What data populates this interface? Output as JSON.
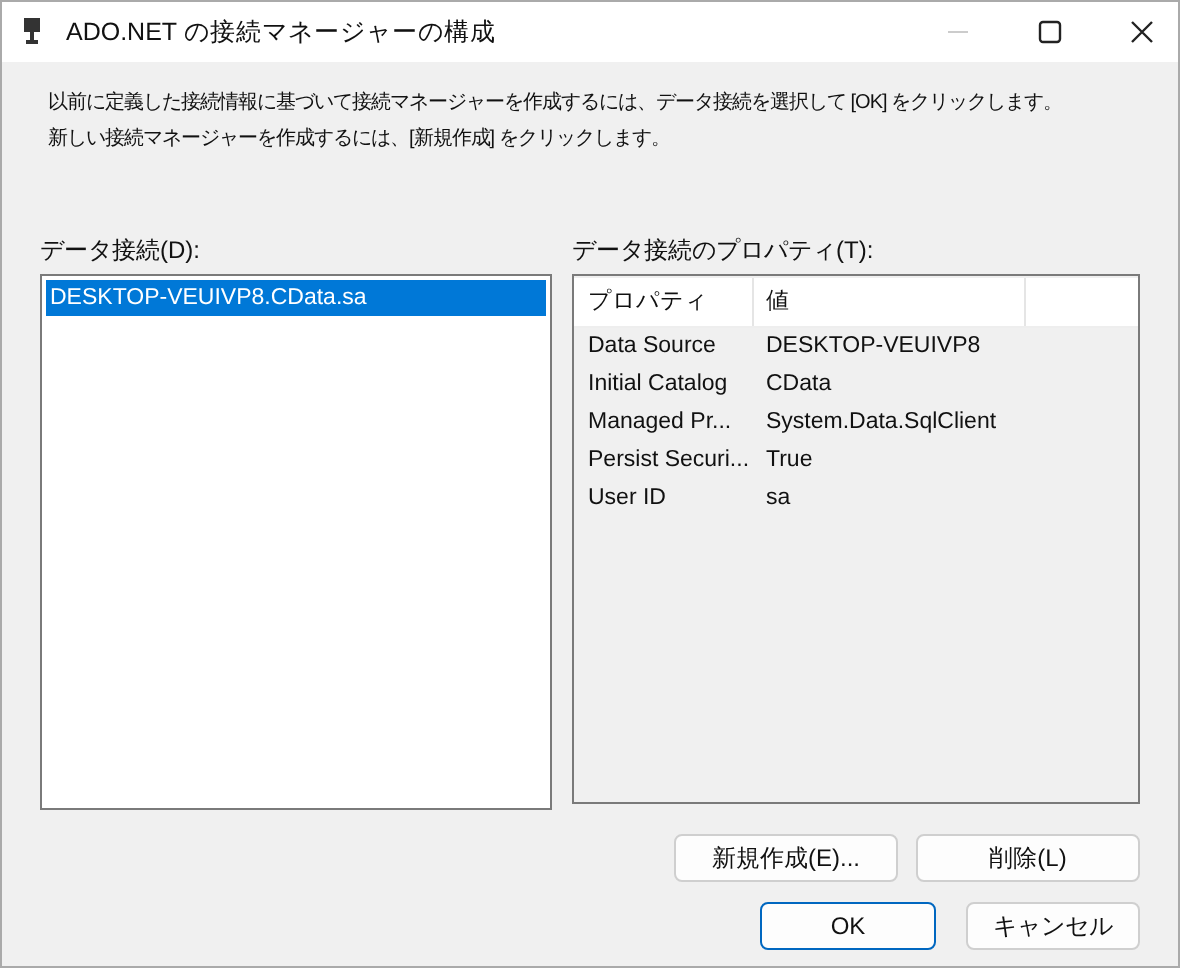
{
  "window": {
    "title": "ADO.NET の接続マネージャーの構成"
  },
  "description": [
    "以前に定義した接続情報に基づいて接続マネージャーを作成するには、データ接続を選択して [OK] をクリックします。",
    "新しい接続マネージャーを作成するには、[新規作成] をクリックします。"
  ],
  "connections": {
    "label": "データ接続(D):",
    "items": [
      {
        "text": "DESKTOP-VEUIVP8.CData.sa",
        "selected": true
      }
    ]
  },
  "properties": {
    "label": "データ接続のプロパティ(T):",
    "columns": [
      "プロパティ",
      "値"
    ],
    "rows": [
      {
        "name": "Data Source",
        "value": "DESKTOP-VEUIVP8"
      },
      {
        "name": "Initial Catalog",
        "value": "CData"
      },
      {
        "name": "Managed Pr...",
        "value": "System.Data.SqlClient"
      },
      {
        "name": "Persist Securi...",
        "value": "True"
      },
      {
        "name": "User ID",
        "value": "sa"
      }
    ]
  },
  "buttons": [
    {
      "label": "新規作成(E)...",
      "kind": "normal"
    },
    {
      "label": "削除(L)",
      "kind": "normal"
    },
    {
      "label": "OK",
      "kind": "default"
    },
    {
      "label": "キャンセル",
      "kind": "normal"
    }
  ]
}
